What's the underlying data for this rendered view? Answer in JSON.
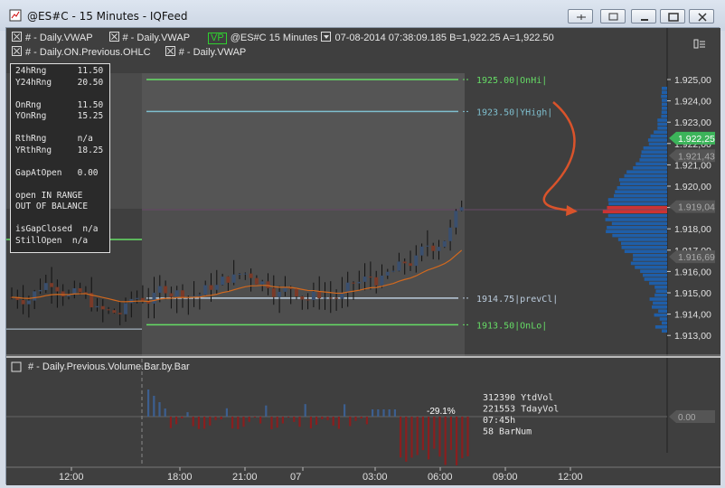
{
  "window": {
    "title": "@ES#C - 15 Minutes - IQFeed"
  },
  "header": {
    "line1": [
      {
        "label": "# - Daily.VWAP"
      },
      {
        "label": "# - Daily.VWAP"
      }
    ],
    "vp": "VP",
    "symbol": "@ES#C  15 Minutes",
    "date": "07-08-2014",
    "time": "07:38:09.185",
    "bid": "B=1,922.25",
    "ask": "A=1,922.50",
    "line2": [
      {
        "label": "# - Daily.ON.Previous.OHLC"
      },
      {
        "label": "# - Daily.VWAP"
      }
    ]
  },
  "infobox": {
    "rows": [
      "24hRng      11.50",
      "Y24hRng     20.50",
      "",
      "OnRng       11.50",
      "YOnRng      15.25",
      "",
      "RthRng      n/a",
      "YRthRng     18.25",
      "",
      "GapAtOpen   0.00",
      "",
      "open IN RANGE",
      "OUT OF BALANCE",
      "",
      "isGapClosed  n/a",
      "StillOpen  n/a"
    ]
  },
  "levels": {
    "onhi": "1925.00|OnHi|",
    "yhigh": "1923.50|YHigh|",
    "prevcl": "1914.75|prevCl|",
    "onlo": "1913.50|OnLo|"
  },
  "price_axis": {
    "ticks": [
      "1.925,00",
      "1.924,00",
      "1.923,00",
      "1.922,00",
      "1.921,00",
      "1.920,00",
      "1.919,00",
      "1.918,00",
      "1.917,00",
      "1.916,00",
      "1.915,00",
      "1.914,00",
      "1.913,00"
    ],
    "last": "1.922,25",
    "marker2": "1.921,43",
    "poc": "1.919,04",
    "marker4": "1.916,69"
  },
  "volume_panel": {
    "title": "# - Daily.Previous.Volume.Bar.by.Bar",
    "pct": "-29.1%",
    "stats": [
      "312390 YtdVol",
      "221553 TdayVol",
      "07:45h",
      "58 BarNum"
    ],
    "zero": "0.00"
  },
  "time_axis": {
    "labels": [
      "12:00",
      "18:00",
      "21:00",
      "07",
      "03:00",
      "06:00",
      "09:00",
      "12:00"
    ]
  },
  "colors": {
    "bg": "#3f3f3f",
    "up": "#3a4f6e",
    "down": "#7a3a28",
    "vwap": "#d2691e",
    "green": "#66dd66",
    "cyan": "#7fbfcf",
    "profile": "#1f5ea8",
    "arrow": "#d9532b"
  }
}
